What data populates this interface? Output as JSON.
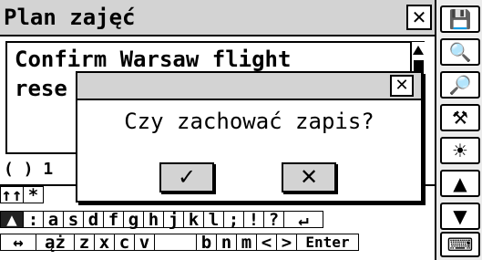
{
  "window": {
    "title": "Plan zajęć",
    "close_icon": "close-icon"
  },
  "note": {
    "lines": [
      "Confirm Warsaw flight",
      "rese"
    ]
  },
  "format_bar": {
    "text": "( ) 1"
  },
  "keyboard": {
    "row1": [
      "↑↑",
      "*",
      "",
      "",
      "",
      "",
      "",
      "",
      "",
      "",
      "",
      "",
      "",
      ""
    ],
    "row2": [
      "▲",
      ":",
      "a",
      "s",
      "d",
      "f",
      "g",
      "h",
      "j",
      "k",
      "l",
      ";",
      "!",
      "?",
      "↵"
    ],
    "row3": [
      "↔",
      "ąż",
      "z",
      "x",
      "c",
      "v",
      "",
      "b",
      "n",
      "m",
      "<",
      ">",
      "Enter"
    ]
  },
  "side": {
    "buttons": [
      "save-icon",
      "find-replace-icon",
      "search-icon",
      "tools-icon",
      "light-icon",
      "scroll-up-icon",
      "scroll-down-icon",
      "keyboard-icon"
    ],
    "glyphs": [
      "💾",
      "🔍",
      "🔎",
      "⚒",
      "☀",
      "▲",
      "▼",
      "⌨"
    ]
  },
  "dialog": {
    "message": "Czy zachować zapis?",
    "ok_glyph": "✓",
    "cancel_glyph": "✕",
    "close_glyph": "✕"
  },
  "colors": {
    "bar": "#d3d3d3",
    "side": "#ececec"
  }
}
